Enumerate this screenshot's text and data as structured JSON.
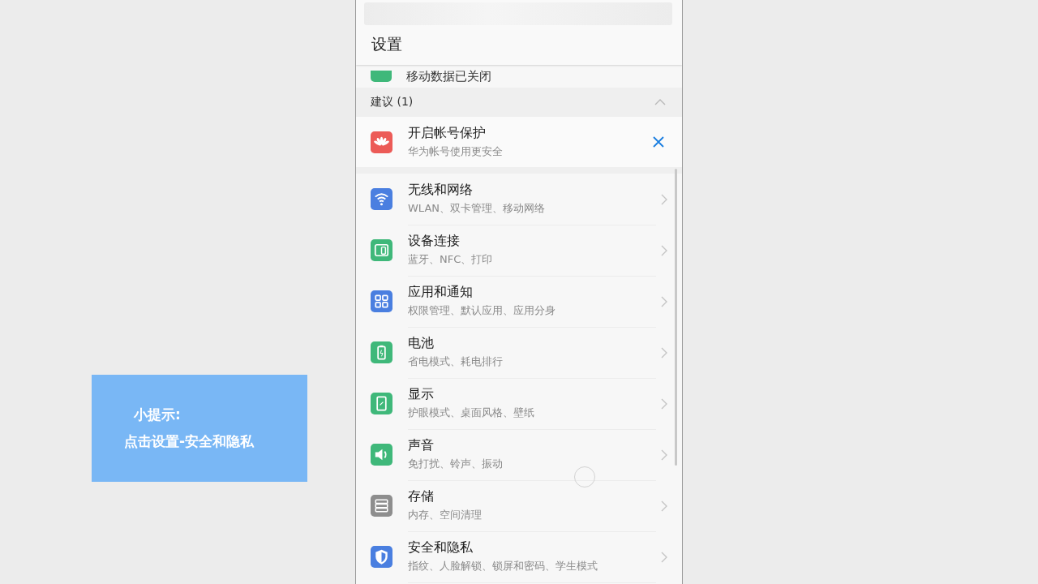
{
  "tip": {
    "title": "小提示:",
    "text": "点击设置-安全和隐私"
  },
  "header": {
    "title": "设置"
  },
  "mobile_data": {
    "title": "移动数据已关闭",
    "color": "#3fb87a"
  },
  "suggestions": {
    "title": "建议 (1)",
    "expanded": true,
    "items": [
      {
        "title": "开启帐号保护",
        "subtitle": "华为帐号使用更安全",
        "color": "#ec5b57"
      }
    ]
  },
  "settings": [
    {
      "title": "无线和网络",
      "subtitle": "WLAN、双卡管理、移动网络",
      "color": "#4a7fe0"
    },
    {
      "title": "设备连接",
      "subtitle": "蓝牙、NFC、打印",
      "color": "#3fb87a"
    },
    {
      "title": "应用和通知",
      "subtitle": "权限管理、默认应用、应用分身",
      "color": "#4a7fe0"
    },
    {
      "title": "电池",
      "subtitle": "省电模式、耗电排行",
      "color": "#3fb87a"
    },
    {
      "title": "显示",
      "subtitle": "护眼模式、桌面风格、壁纸",
      "color": "#3fb87a"
    },
    {
      "title": "声音",
      "subtitle": "免打扰、铃声、振动",
      "color": "#3fb87a"
    },
    {
      "title": "存储",
      "subtitle": "内存、空间清理",
      "color": "#8e8e8e"
    },
    {
      "title": "安全和隐私",
      "subtitle": "指纹、人脸解锁、锁屏和密码、学生模式",
      "color": "#4a7fe0"
    }
  ]
}
